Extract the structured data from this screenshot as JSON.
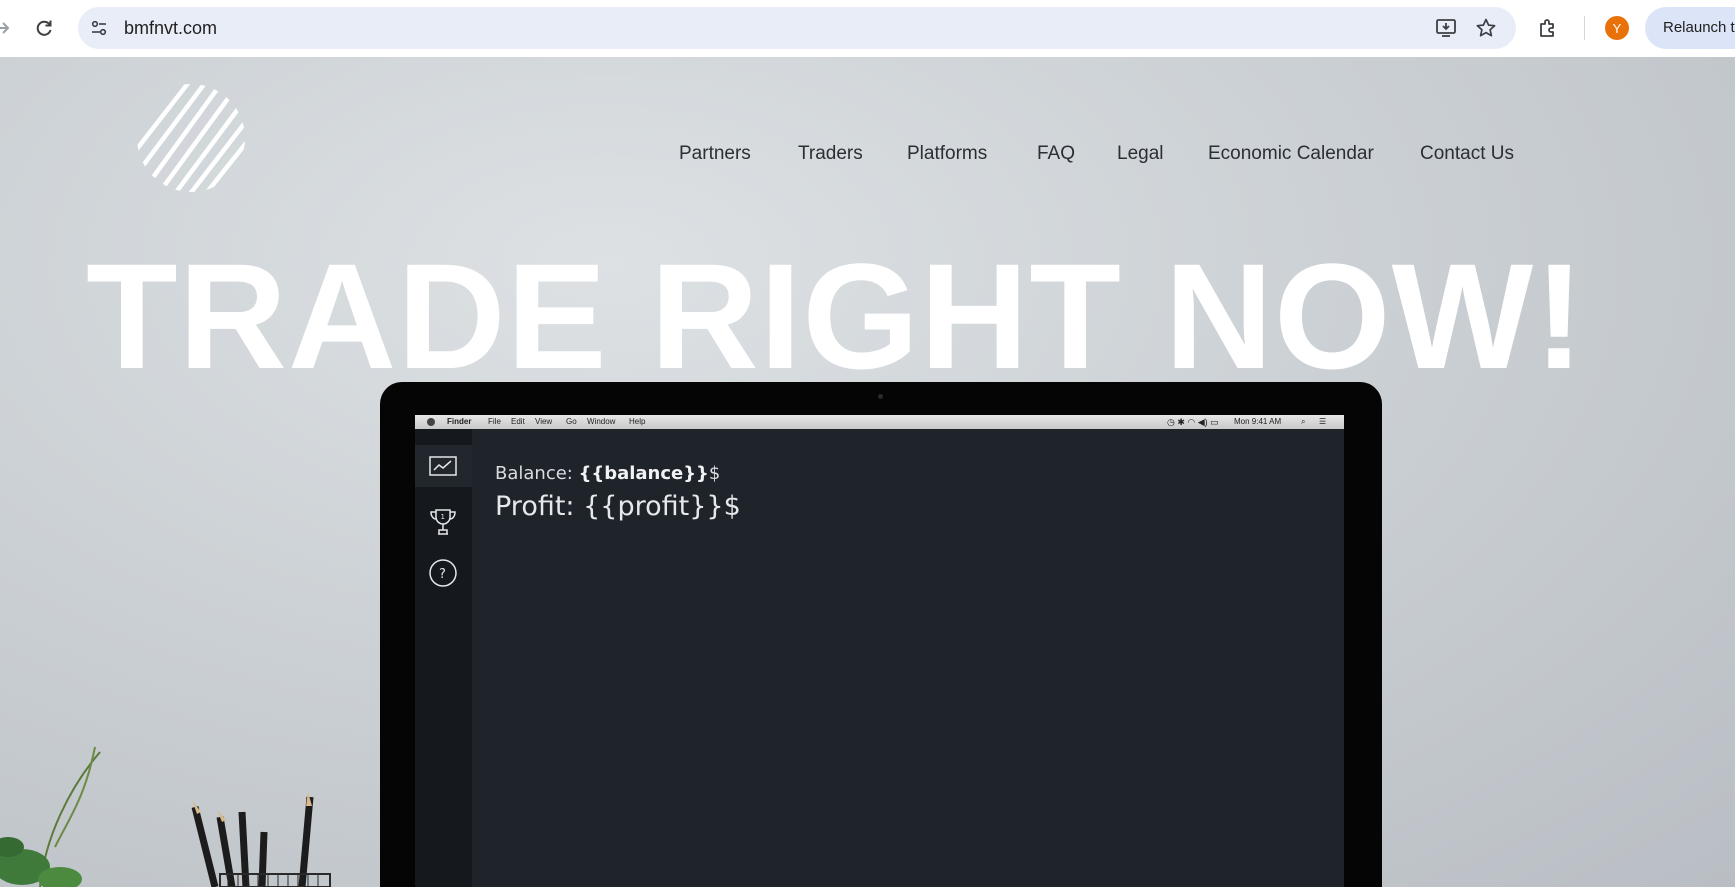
{
  "browser": {
    "url": "bmfnvt.com",
    "profile_initial": "Y",
    "relaunch_label": "Relaunch to update",
    "icons": [
      "forward-icon",
      "reload-icon",
      "site-settings-icon",
      "install-app-icon",
      "bookmark-star-icon",
      "extensions-icon"
    ]
  },
  "site": {
    "nav": [
      "Partners",
      "Traders",
      "Platforms",
      "FAQ",
      "Legal",
      "Economic Calendar",
      "Contact Us"
    ],
    "headline": "TRADE RIGHT NOW!"
  },
  "mockup": {
    "menubar": {
      "items": [
        "Finder",
        "File",
        "Edit",
        "View",
        "Go",
        "Window",
        "Help"
      ],
      "clock": "Mon 9:41 AM"
    },
    "balance_label": "Balance: ",
    "balance_value": "{{balance}}",
    "balance_suffix": "$",
    "profit_text": "Profit: {{profit}}$"
  }
}
